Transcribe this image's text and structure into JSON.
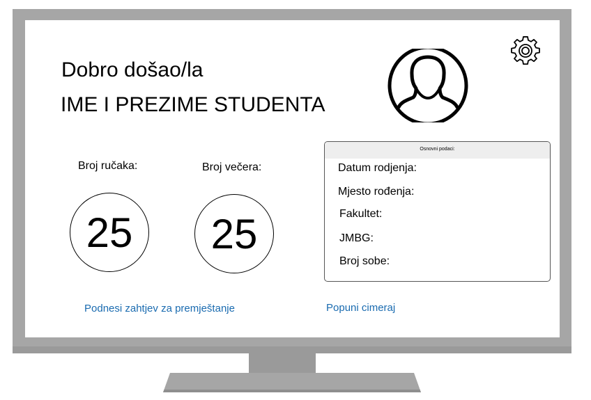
{
  "header": {
    "welcome": "Dobro došao/la",
    "student_name": "IME I PREZIME STUDENTA"
  },
  "icons": {
    "avatar": "user-avatar-icon",
    "settings": "gear-icon"
  },
  "meals": {
    "lunch_label": "Broj ručaka:",
    "lunch_count": "25",
    "dinner_label": "Broj večera:",
    "dinner_count": "25"
  },
  "info_card": {
    "title": "Osnovni podaci:",
    "rows": [
      "Datum rodjenja:",
      "Mjesto rođenja:",
      "Fakultet:",
      "JMBG:",
      "Broj sobe:"
    ]
  },
  "actions": {
    "transfer_request": "Podnesi zahtjev za premještanje",
    "fill_roommates": "Popuni cimeraj"
  },
  "colors": {
    "link": "#1a6bb0",
    "bezel": "#a6a6a6",
    "card_header": "#eeeeee"
  }
}
